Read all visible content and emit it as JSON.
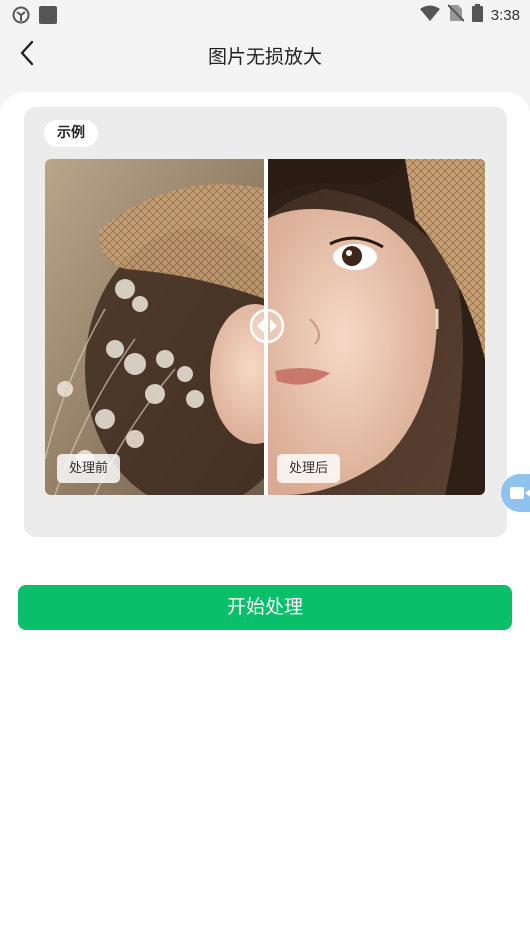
{
  "status_bar": {
    "time": "3:38",
    "icons": [
      "sync-icon",
      "app-square-icon",
      "wifi-icon",
      "no-sim-icon",
      "battery-icon"
    ]
  },
  "header": {
    "title": "图片无损放大",
    "back_icon": "back-arrow-icon"
  },
  "example": {
    "badge": "示例",
    "before_label": "处理前",
    "after_label": "处理后",
    "slider_icon": "compare-slider-icon"
  },
  "floating_button": {
    "icon": "video-camera-icon",
    "color": "#8fc2ee"
  },
  "actions": {
    "start_label": "开始处理",
    "start_color": "#0abf6a"
  }
}
